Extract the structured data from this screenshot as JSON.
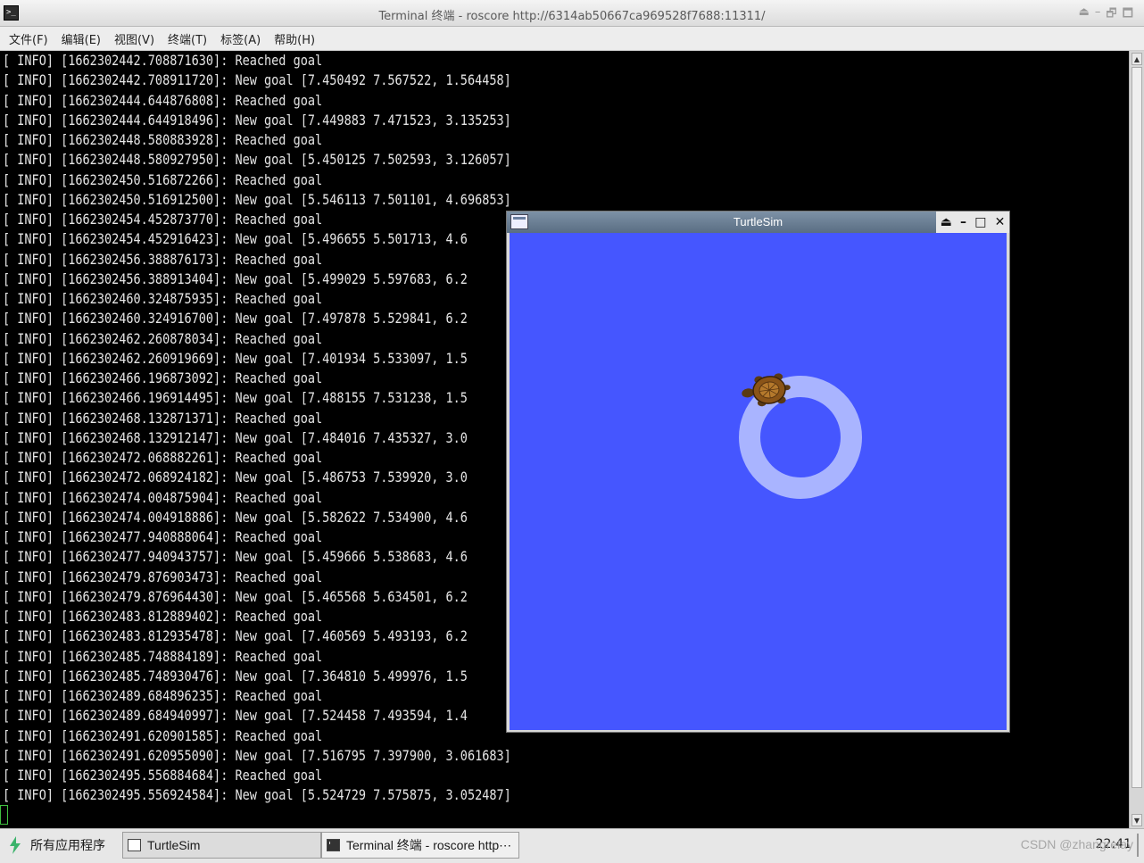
{
  "window": {
    "title": "Terminal 终端 - roscore http://6314ab50667ca969528f7688:11311/",
    "controls": [
      "⏏",
      "–",
      "🗗",
      "🗖"
    ]
  },
  "menu": [
    {
      "label": "文件(F)"
    },
    {
      "label": "编辑(E)"
    },
    {
      "label": "视图(V)"
    },
    {
      "label": "终端(T)"
    },
    {
      "label": "标签(A)"
    },
    {
      "label": "帮助(H)"
    }
  ],
  "terminal": {
    "lines": [
      "[ INFO] [1662302442.708871630]: Reached goal",
      "[ INFO] [1662302442.708911720]: New goal [7.450492 7.567522, 1.564458]",
      "[ INFO] [1662302444.644876808]: Reached goal",
      "[ INFO] [1662302444.644918496]: New goal [7.449883 7.471523, 3.135253]",
      "[ INFO] [1662302448.580883928]: Reached goal",
      "[ INFO] [1662302448.580927950]: New goal [5.450125 7.502593, 3.126057]",
      "[ INFO] [1662302450.516872266]: Reached goal",
      "[ INFO] [1662302450.516912500]: New goal [5.546113 7.501101, 4.696853]",
      "[ INFO] [1662302454.452873770]: Reached goal",
      "[ INFO] [1662302454.452916423]: New goal [5.496655 5.501713, 4.6",
      "[ INFO] [1662302456.388876173]: Reached goal",
      "[ INFO] [1662302456.388913404]: New goal [5.499029 5.597683, 6.2",
      "[ INFO] [1662302460.324875935]: Reached goal",
      "[ INFO] [1662302460.324916700]: New goal [7.497878 5.529841, 6.2",
      "[ INFO] [1662302462.260878034]: Reached goal",
      "[ INFO] [1662302462.260919669]: New goal [7.401934 5.533097, 1.5",
      "[ INFO] [1662302466.196873092]: Reached goal",
      "[ INFO] [1662302466.196914495]: New goal [7.488155 7.531238, 1.5",
      "[ INFO] [1662302468.132871371]: Reached goal",
      "[ INFO] [1662302468.132912147]: New goal [7.484016 7.435327, 3.0",
      "[ INFO] [1662302472.068882261]: Reached goal",
      "[ INFO] [1662302472.068924182]: New goal [5.486753 7.539920, 3.0",
      "[ INFO] [1662302474.004875904]: Reached goal",
      "[ INFO] [1662302474.004918886]: New goal [5.582622 7.534900, 4.6",
      "[ INFO] [1662302477.940888064]: Reached goal",
      "[ INFO] [1662302477.940943757]: New goal [5.459666 5.538683, 4.6",
      "[ INFO] [1662302479.876903473]: Reached goal",
      "[ INFO] [1662302479.876964430]: New goal [5.465568 5.634501, 6.2",
      "[ INFO] [1662302483.812889402]: Reached goal",
      "[ INFO] [1662302483.812935478]: New goal [7.460569 5.493193, 6.2",
      "[ INFO] [1662302485.748884189]: Reached goal",
      "[ INFO] [1662302485.748930476]: New goal [7.364810 5.499976, 1.5",
      "[ INFO] [1662302489.684896235]: Reached goal",
      "[ INFO] [1662302489.684940997]: New goal [7.524458 7.493594, 1.4",
      "[ INFO] [1662302491.620901585]: Reached goal",
      "[ INFO] [1662302491.620955090]: New goal [7.516795 7.397900, 3.061683]",
      "[ INFO] [1662302495.556884684]: Reached goal",
      "[ INFO] [1662302495.556924584]: New goal [5.524729 7.575875, 3.052487]"
    ]
  },
  "turtlesim": {
    "title": "TurtleSim",
    "background_color": "#4556ff",
    "trail_color": "#a9b4ff",
    "controls": [
      "⏏",
      "–",
      "□",
      "✕"
    ]
  },
  "taskbar": {
    "start_label": "所有应用程序",
    "tasks": [
      {
        "label": "TurtleSim"
      },
      {
        "label": "Terminal 终端 - roscore http⋯"
      }
    ],
    "clock": "22:41"
  },
  "watermark": "CSDN @zhangrelay"
}
